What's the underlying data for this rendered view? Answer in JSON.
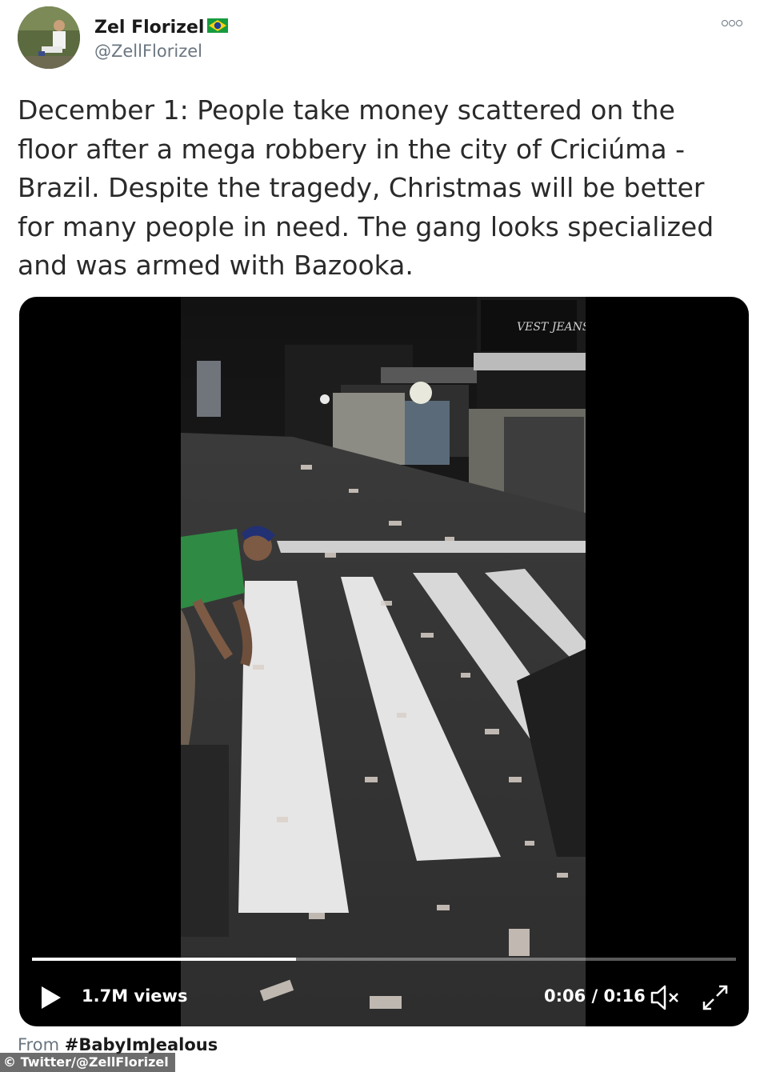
{
  "user": {
    "display_name": "Zel Florizel",
    "flag_icon": "brazil-flag-icon",
    "handle": "@ZellFlorizel"
  },
  "tweet": {
    "text": "December 1: People take money scattered on the floor after a mega robbery in the city of Criciúma - Brazil. Despite the tragedy, Christmas will be better for many people in need. The gang looks specialized and was armed with Bazooka."
  },
  "video": {
    "storefront_sign": "VEST JEANS",
    "views": "1.7M views",
    "time": "0:06 / 0:16",
    "progress_fraction": 0.375
  },
  "footer": {
    "from_label": "From",
    "hashtag": "#BabyImJealous",
    "watermark": "© Twitter/@ZellFlorizel"
  },
  "colors": {
    "secondary_text": "#6b7680",
    "video_bg": "#000000",
    "flag_green": "#169b3e",
    "flag_yellow": "#f6d312",
    "flag_blue": "#1f3f99"
  }
}
